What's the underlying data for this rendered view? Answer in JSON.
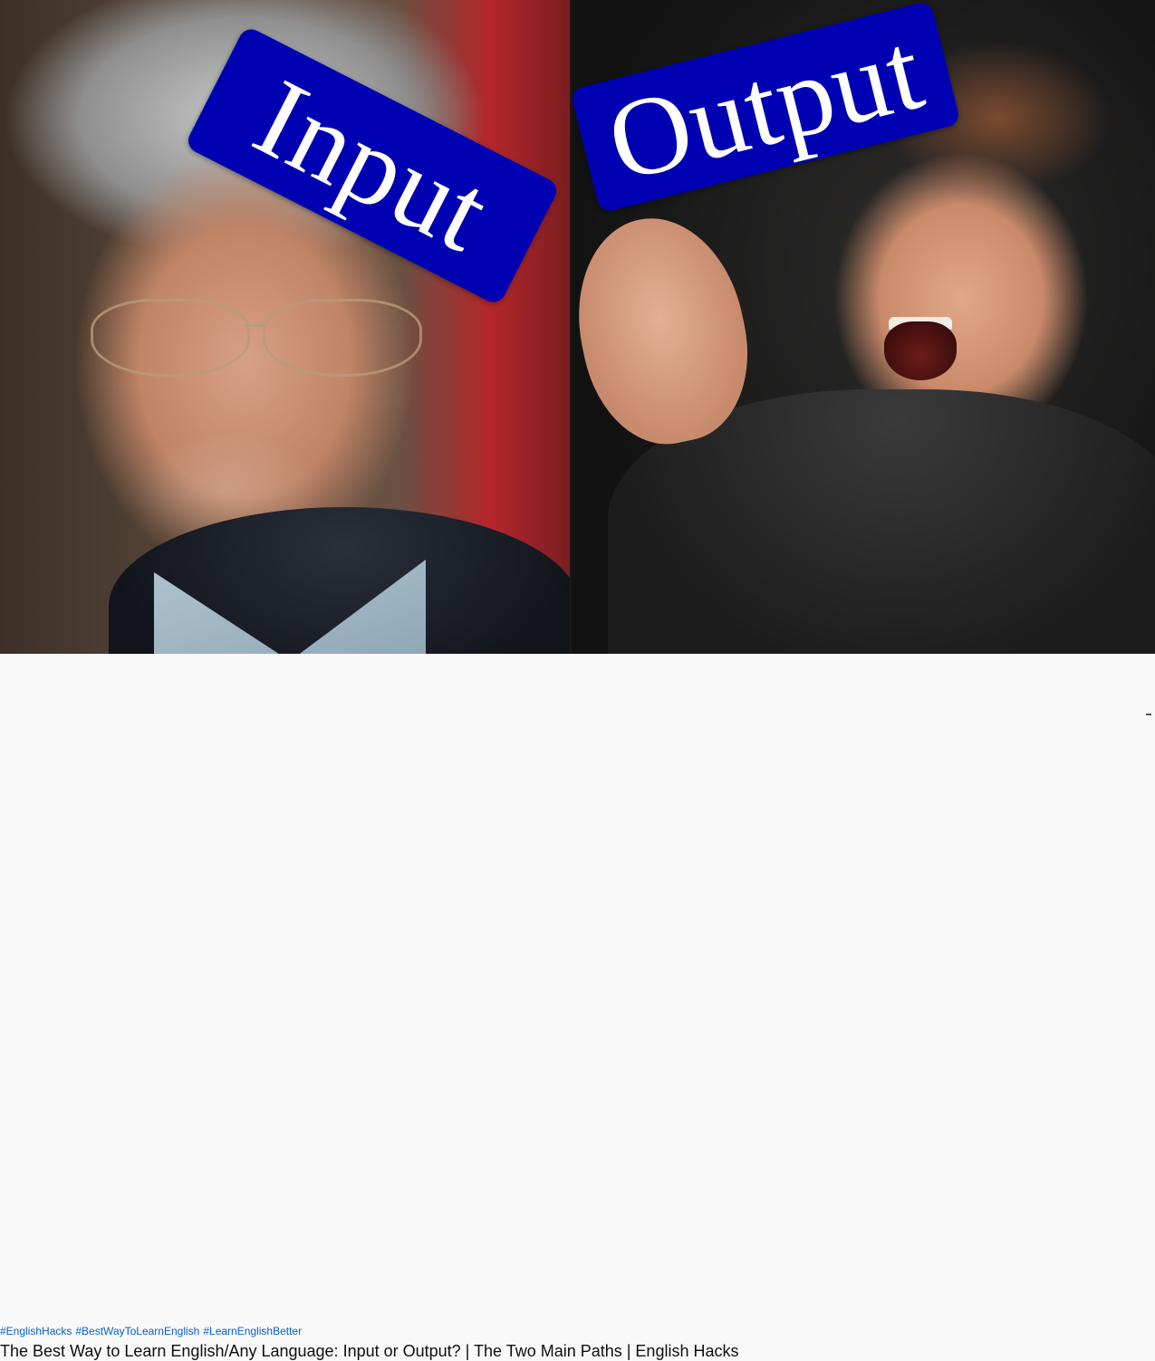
{
  "thumbnail": {
    "left_sign": "Input",
    "right_sign": "Output",
    "sign_color": "#0000b3"
  },
  "video": {
    "hashtags": [
      "#EnglishHacks",
      "#BestWayToLearnEnglish",
      "#LearnEnglishBetter"
    ],
    "title": "The Best Way to Learn English/Any Language: Input or Output? | The Two Main Paths | English Hacks"
  }
}
